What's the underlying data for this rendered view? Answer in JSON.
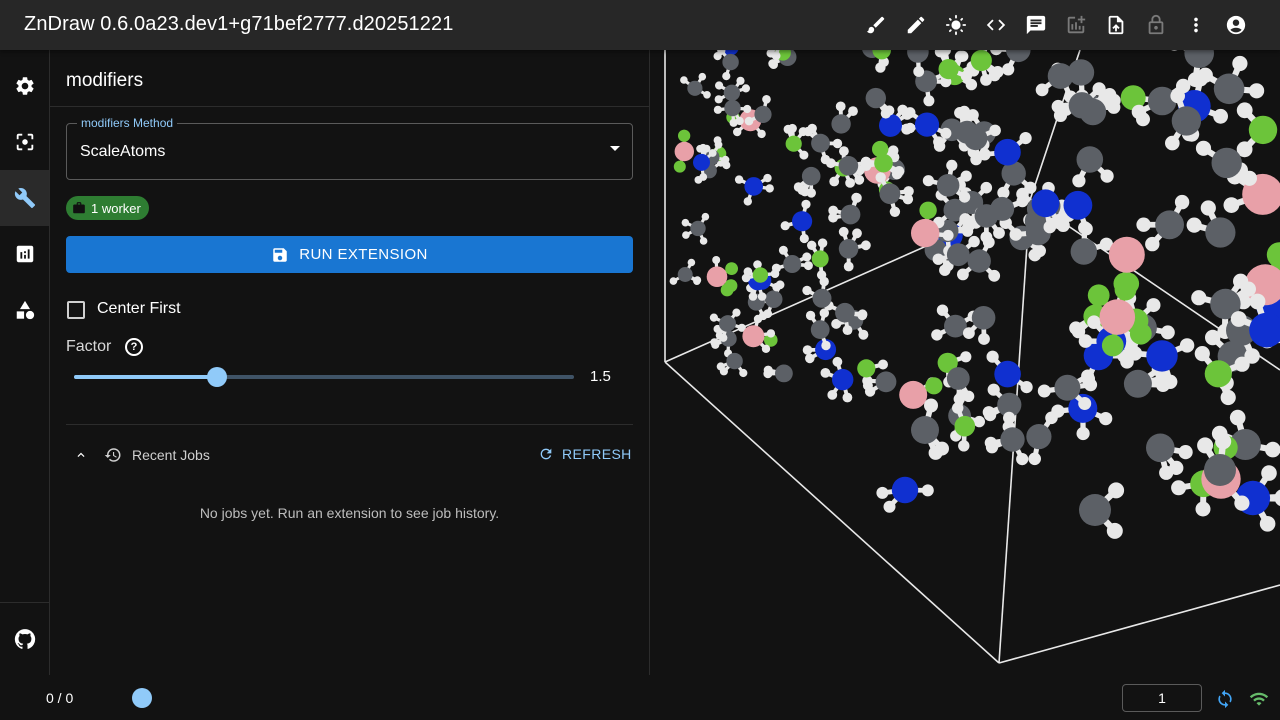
{
  "app": {
    "title": "ZnDraw 0.6.0a23.dev1+g71bef2777.d20251221"
  },
  "toolbar": {
    "icons": [
      "brush-icon",
      "pencil-icon",
      "brightness-icon",
      "code-icon",
      "chat-icon",
      "add-chart-icon",
      "file-upload-icon",
      "lock-icon",
      "more-vert-icon",
      "account-icon"
    ]
  },
  "sidebar": {
    "items": [
      "settings",
      "selection",
      "modifiers",
      "analysis",
      "geometries"
    ],
    "active": "modifiers",
    "bottom": "github"
  },
  "panel": {
    "title": "modifiers",
    "method_label": "modifiers Method",
    "method_value": "ScaleAtoms",
    "worker_chip": "1 worker",
    "run_button": "RUN EXTENSION",
    "center_first_label": "Center First",
    "center_first_checked": false,
    "factor_label": "Factor",
    "factor_help": "?",
    "factor_value": "1.5",
    "factor_fraction": 0.286,
    "recent_jobs_title": "Recent Jobs",
    "refresh_label": "REFRESH",
    "no_jobs_text": "No jobs yet. Run an extension to see job history."
  },
  "bottom": {
    "frame_count": "0 / 0",
    "frame_input": "1"
  },
  "colors": {
    "accent": "#90caf9",
    "primary_button": "#1976d2",
    "worker_chip": "#2e7d32",
    "atom_carbon": "#5c6066",
    "atom_hydrogen": "#e8e8e8",
    "atom_nitrogen": "#1030d0",
    "atom_chlorine": "#6cc43a",
    "atom_boron": "#e8a0a8"
  }
}
